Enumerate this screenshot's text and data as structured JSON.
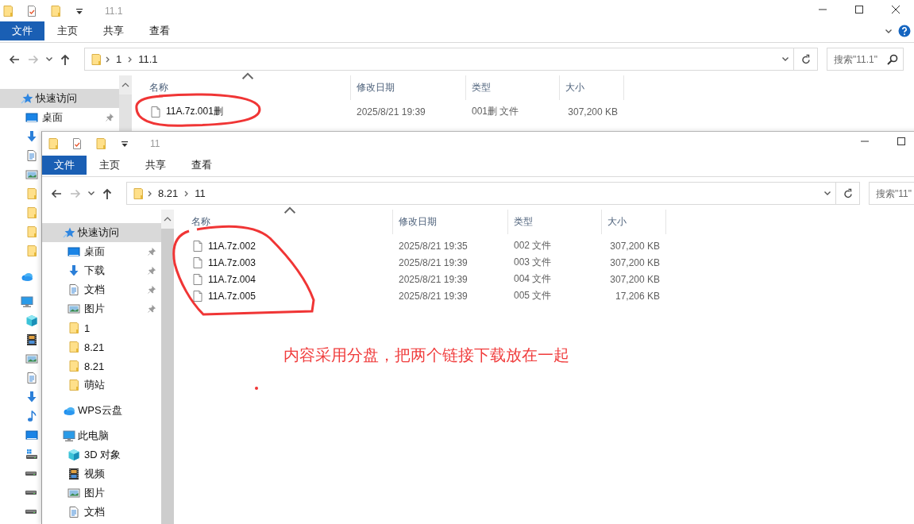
{
  "windows": [
    {
      "title": "11.1",
      "window_controls": [
        {
          "kind": "minimize"
        },
        {
          "kind": "maximize"
        },
        {
          "kind": "close"
        }
      ],
      "help_button": true,
      "ribbon_tabs": [
        {
          "label": "文件",
          "selected": true
        },
        {
          "label": "主页",
          "selected": false
        },
        {
          "label": "共享",
          "selected": false
        },
        {
          "label": "查看",
          "selected": false
        }
      ],
      "address": {
        "path": [
          "1",
          "11.1"
        ]
      },
      "search": {
        "placeholder": "搜索\"11.1\""
      },
      "sidebar": [
        {
          "kind": "star",
          "label": "快速访问",
          "selected": true,
          "children": [
            {
              "kind": "desktop",
              "label": "桌面",
              "pinned": true,
              "selected": false
            },
            {
              "kind": "download",
              "selected": false
            },
            {
              "kind": "doc",
              "selected": false
            },
            {
              "kind": "picture",
              "selected": false
            },
            {
              "kind": "folder",
              "selected": false
            },
            {
              "kind": "folder",
              "selected": false
            },
            {
              "kind": "folder",
              "selected": false
            },
            {
              "kind": "folder",
              "selected": false
            }
          ]
        },
        {
          "kind": "cloud",
          "selected": false
        },
        {
          "kind": "pc",
          "selected": false,
          "children": [
            {
              "kind": "cube",
              "selected": false
            },
            {
              "kind": "video",
              "selected": false
            },
            {
              "kind": "picture",
              "selected": false
            },
            {
              "kind": "doc",
              "selected": false
            },
            {
              "kind": "download",
              "selected": false
            },
            {
              "kind": "music",
              "selected": false
            },
            {
              "kind": "desktop",
              "selected": false
            },
            {
              "kind": "drive-win",
              "selected": false
            },
            {
              "kind": "drive",
              "selected": false
            },
            {
              "kind": "drive",
              "selected": false
            },
            {
              "kind": "drive",
              "selected": false
            }
          ]
        }
      ],
      "table": {
        "columns": [
          "名称",
          "修改日期",
          "类型",
          "大小"
        ],
        "rows": [
          {
            "name": "11A.7z.001删",
            "modified": "2025/8/21 19:39",
            "type": "001删 文件",
            "size": "307,200 KB"
          }
        ]
      }
    },
    {
      "title": "11",
      "window_controls": [
        {
          "kind": "minimize"
        },
        {
          "kind": "maximize"
        }
      ],
      "ribbon_tabs": [
        {
          "label": "文件",
          "selected": true
        },
        {
          "label": "主页",
          "selected": false
        },
        {
          "label": "共享",
          "selected": false
        },
        {
          "label": "查看",
          "selected": false
        }
      ],
      "address": {
        "path": [
          "8.21",
          "11"
        ]
      },
      "search": {
        "placeholder": "搜索\"11\""
      },
      "sidebar": [
        {
          "kind": "star",
          "label": "快速访问",
          "selected": true,
          "children": [
            {
              "kind": "desktop",
              "label": "桌面",
              "pinned": true,
              "selected": false
            },
            {
              "kind": "download",
              "label": "下载",
              "pinned": true,
              "selected": false
            },
            {
              "kind": "doc",
              "label": "文档",
              "pinned": true,
              "selected": false
            },
            {
              "kind": "picture",
              "label": "图片",
              "pinned": true,
              "selected": false
            },
            {
              "kind": "folder",
              "label": "1",
              "pinned": false,
              "selected": false
            },
            {
              "kind": "folder",
              "label": "8.21",
              "pinned": false,
              "selected": false
            },
            {
              "kind": "folder",
              "label": "8.21",
              "pinned": false,
              "selected": false
            },
            {
              "kind": "folder",
              "label": "萌站",
              "pinned": false,
              "selected": false
            }
          ]
        },
        {
          "kind": "cloud",
          "label": "WPS云盘",
          "selected": false
        },
        {
          "kind": "pc",
          "label": "此电脑",
          "selected": false,
          "children": [
            {
              "kind": "cube",
              "label": "3D 对象",
              "selected": false
            },
            {
              "kind": "video",
              "label": "视频",
              "selected": false
            },
            {
              "kind": "picture",
              "label": "图片",
              "selected": false
            },
            {
              "kind": "doc",
              "label": "文档",
              "selected": false
            }
          ]
        }
      ],
      "table": {
        "columns": [
          "名称",
          "修改日期",
          "类型",
          "大小"
        ],
        "rows": [
          {
            "name": "11A.7z.002",
            "modified": "2025/8/21 19:35",
            "type": "002 文件",
            "size": "307,200 KB"
          },
          {
            "name": "11A.7z.003",
            "modified": "2025/8/21 19:39",
            "type": "003 文件",
            "size": "307,200 KB"
          },
          {
            "name": "11A.7z.004",
            "modified": "2025/8/21 19:39",
            "type": "004 文件",
            "size": "307,200 KB"
          },
          {
            "name": "11A.7z.005",
            "modified": "2025/8/21 19:39",
            "type": "005 文件",
            "size": "17,206 KB"
          }
        ]
      }
    }
  ],
  "annotation": {
    "text": "内容采用分盘，把两个链接下载放在一起"
  }
}
